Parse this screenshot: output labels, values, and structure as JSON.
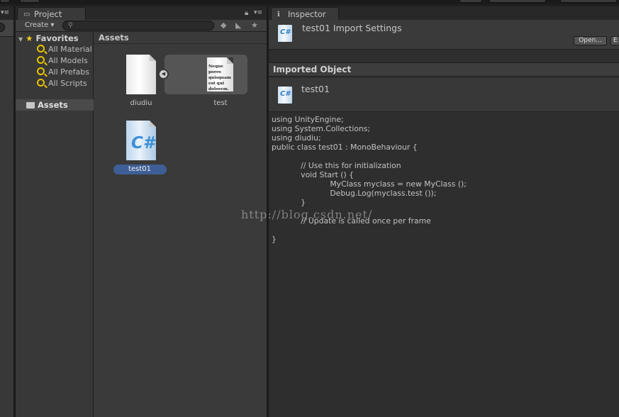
{
  "left_panel": {
    "menu_icon": "panel-menu-icon"
  },
  "project": {
    "tab_label": "Project",
    "tab_icon": "folder-icon",
    "create_label": "Create ▾",
    "search_placeholder": "",
    "favorites": {
      "label": "Favorites",
      "items": [
        "All Material",
        "All Models",
        "All Prefabs",
        "All Scripts"
      ]
    },
    "tree_assets_label": "Assets",
    "grid_header": "Assets",
    "grid_items": [
      {
        "name": "diudiu",
        "icon": "text-asset-icon"
      },
      {
        "name": "test",
        "icon": "text-asset-preview-icon",
        "preview_text": "Neque porro quisquam est qui dolorem."
      },
      {
        "name": "test01",
        "icon": "csharp-script-icon",
        "selected": true
      }
    ]
  },
  "inspector": {
    "tab_label": "Inspector",
    "title": "test01 Import Settings",
    "open_label": "Open...",
    "ext_label": "E",
    "imported_object_header": "Imported Object",
    "object_name": "test01",
    "code": "using UnityEngine;\nusing System.Collections;\nusing diudiu;\npublic class test01 : MonoBehaviour {\n\n            // Use this for initialization\n            void Start () {\n                        MyClass myclass = new MyClass ();\n                        Debug.Log(myclass.test ());\n            }\n\n            // Update is called once per frame\n\n}"
  },
  "watermark": "http://blog.csdn.net/",
  "colors": {
    "selection": "#3e5f96",
    "accent_yellow": "#e8c300",
    "csharp_blue": "#3d8fd6"
  }
}
